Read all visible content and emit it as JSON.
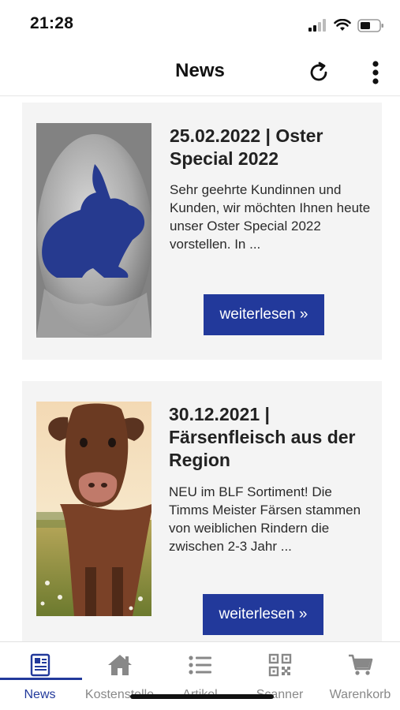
{
  "status_bar": {
    "time": "21:28"
  },
  "header": {
    "title": "News"
  },
  "news": [
    {
      "title": "25.02.2022 | Oster Special 2022",
      "excerpt": "Sehr geehrte Kundinnen und Kunden, wir möchten Ihnen heute unser Oster Special 2022 vorstellen. In ...",
      "button": "weiterlesen »"
    },
    {
      "title": "30.12.2021 | Färsenfleisch aus der Region",
      "excerpt": "NEU im BLF Sortiment! Die Timms Meister Färsen stammen von weiblichen Rindern die zwischen 2-3 Jahr ...",
      "button": "weiterlesen »"
    }
  ],
  "nav": [
    {
      "label": "News",
      "icon": "newspaper-icon",
      "active": true
    },
    {
      "label": "Kostenstelle",
      "icon": "home-icon",
      "active": false
    },
    {
      "label": "Artikel",
      "icon": "list-icon",
      "active": false
    },
    {
      "label": "Scanner",
      "icon": "qr-code-icon",
      "active": false
    },
    {
      "label": "Warenkorb",
      "icon": "cart-icon",
      "active": false
    }
  ],
  "colors": {
    "accent": "#22399b",
    "card_bg": "#f4f4f4",
    "inactive": "#888888"
  }
}
